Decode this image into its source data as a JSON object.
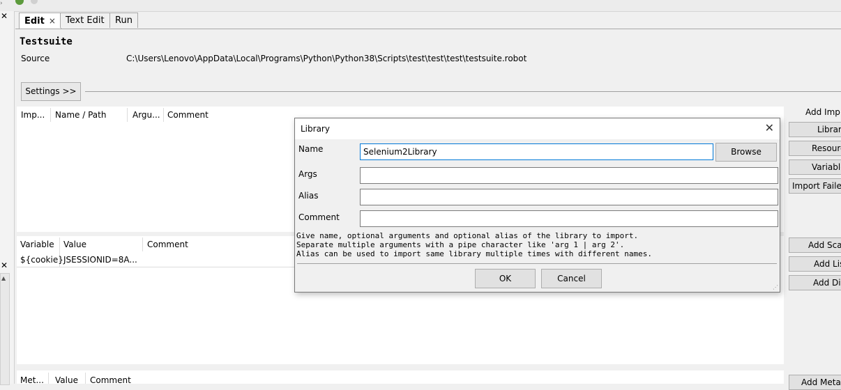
{
  "tabs": [
    {
      "label": "Edit",
      "close": "×"
    },
    {
      "label": "Text Edit"
    },
    {
      "label": "Run"
    }
  ],
  "suite": {
    "title": "Testsuite",
    "source_label": "Source",
    "source_path": "C:\\Users\\Lenovo\\AppData\\Local\\Programs\\Python\\Python38\\Scripts\\test\\test\\test\\testsuite.robot"
  },
  "settings_button": "Settings >>",
  "imports": {
    "columns": [
      "Imp...",
      "Name / Path",
      "Argu...",
      "Comment"
    ]
  },
  "variables": {
    "columns": [
      "Variable",
      "Value",
      "Comment"
    ],
    "rows": [
      {
        "name": "${cookie}",
        "value": "JSESSIONID=8A..."
      }
    ]
  },
  "metadata": {
    "columns": [
      "Met...",
      "Value",
      "Comment"
    ]
  },
  "right_panel": {
    "add_import_label": "Add Imp",
    "buttons": [
      "Library",
      "Resource",
      "Variable",
      "Import Failed",
      "Add Scalar",
      "Add List",
      "Add Dict",
      "Add Meta"
    ]
  },
  "dialog": {
    "title": "Library",
    "close": "✕",
    "name_label": "Name",
    "name_value": "Selenium2Library",
    "browse": "Browse",
    "args_label": "Args",
    "alias_label": "Alias",
    "comment_label": "Comment",
    "help_lines": [
      "Give name, optional arguments and optional alias of the library to import.",
      "Separate multiple arguments with a pipe character like 'arg 1 | arg 2'.",
      "Alias can be used to import same library multiple times with different names."
    ],
    "ok": "OK",
    "cancel": "Cancel"
  }
}
